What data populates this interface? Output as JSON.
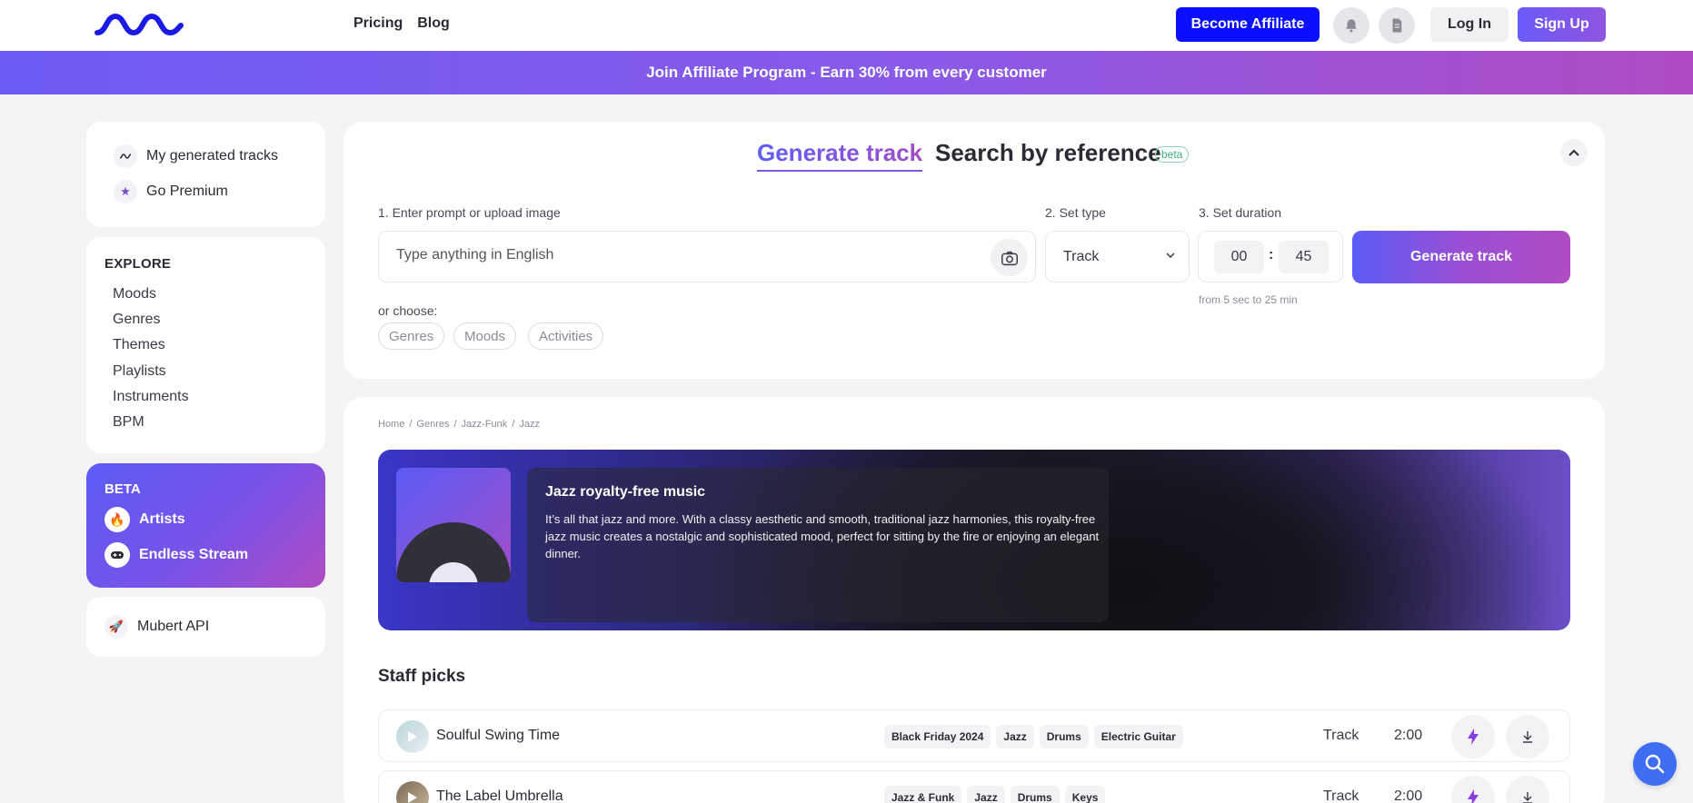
{
  "header": {
    "nav": [
      "Pricing",
      "Blog"
    ],
    "affiliate_label": "Become Affiliate",
    "login_label": "Log In",
    "signup_label": "Sign Up"
  },
  "banner": {
    "text": "Join Affiliate Program - Earn 30% from every customer"
  },
  "sidebar": {
    "top_items": [
      {
        "label": "My generated tracks",
        "icon": "waveform-icon"
      },
      {
        "label": "Go Premium",
        "icon": "star-icon"
      }
    ],
    "explore_title": "EXPLORE",
    "explore_links": [
      "Moods",
      "Genres",
      "Themes",
      "Playlists",
      "Instruments",
      "BPM"
    ],
    "beta": {
      "label": "BETA",
      "items": [
        {
          "label": "Artists",
          "icon": "fire-icon"
        },
        {
          "label": "Endless Stream",
          "icon": "gamepad-icon"
        }
      ]
    },
    "api_item": {
      "label": "Mubert API",
      "icon": "rocket-icon"
    }
  },
  "generator": {
    "tab_generate": "Generate track",
    "tab_reference": "Search by reference",
    "beta_badge": "beta",
    "step1": "1. Enter prompt or upload image",
    "step2": "2. Set type",
    "step3": "3. Set duration",
    "prompt_placeholder": "Type anything in English",
    "type_value": "Track",
    "duration_min": "00",
    "duration_sec": "45",
    "duration_hint": "from 5 sec to 25 min",
    "generate_label": "Generate track",
    "or_choose": "or choose:",
    "chips": [
      "Genres",
      "Moods",
      "Activities"
    ]
  },
  "breadcrumb": [
    "Home",
    "Genres",
    "Jazz-Funk",
    "Jazz"
  ],
  "hero": {
    "title": "Jazz royalty-free music",
    "description": "It’s all that jazz and more. With a classy aesthetic and smooth, traditional jazz harmonies, this royalty-free jazz music creates a nostalgic and sophisticated mood, perfect for sitting by the fire or enjoying an elegant dinner."
  },
  "staff_picks": {
    "title": "Staff picks",
    "tracks": [
      {
        "name": "Soulful Swing Time",
        "tags": [
          "Black Friday 2024",
          "Jazz",
          "Drums",
          "Electric Guitar"
        ],
        "type": "Track",
        "duration": "2:00"
      },
      {
        "name": "The Label Umbrella",
        "tags": [
          "Jazz & Funk",
          "Jazz",
          "Drums",
          "Keys"
        ],
        "type": "Track",
        "duration": "2:00"
      }
    ]
  },
  "colors": {
    "accent": "#6a5af9",
    "brand_blue": "#0a0fff",
    "gradient_end": "#b04cc2"
  }
}
